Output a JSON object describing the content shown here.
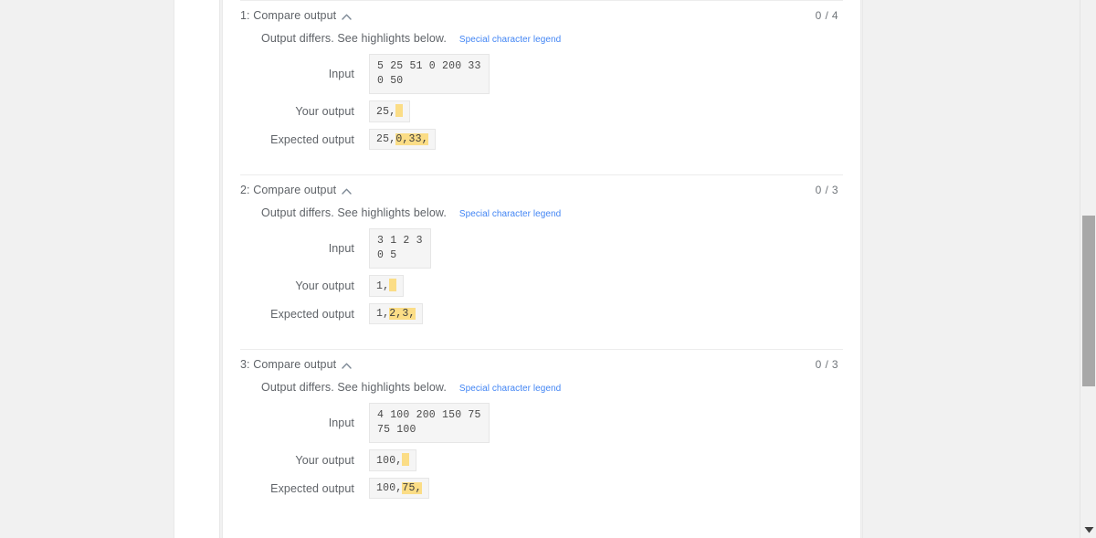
{
  "scrollbar": {
    "arrow_down_icon": "triangle-down-icon"
  },
  "results": {
    "sections": [
      {
        "title": "1: Compare output",
        "collapse_icon": "chevron-up-icon",
        "score": "0 / 4",
        "status_text": "Output differs. See highlights below.",
        "legend_link": "Special character legend",
        "input_label": "Input",
        "input_value": "5 25 51 0 200 33\n0 50",
        "your_output_label": "Your output",
        "your_output_prefix": "25,",
        "your_output_highlight": "",
        "expected_output_label": "Expected output",
        "expected_prefix": "25,",
        "expected_highlight": "0,33,"
      },
      {
        "title": "2: Compare output",
        "collapse_icon": "chevron-up-icon",
        "score": "0 / 3",
        "status_text": "Output differs. See highlights below.",
        "legend_link": "Special character legend",
        "input_label": "Input",
        "input_value": "3 1 2 3\n0 5",
        "your_output_label": "Your output",
        "your_output_prefix": "1,",
        "your_output_highlight": "",
        "expected_output_label": "Expected output",
        "expected_prefix": "1,",
        "expected_highlight": "2,3,"
      },
      {
        "title": "3: Compare output",
        "collapse_icon": "chevron-up-icon",
        "score": "0 / 3",
        "status_text": "Output differs. See highlights below.",
        "legend_link": "Special character legend",
        "input_label": "Input",
        "input_value": "4 100 200 150 75\n75 100",
        "your_output_label": "Your output",
        "your_output_prefix": "100,",
        "your_output_highlight": "",
        "expected_output_label": "Expected output",
        "expected_prefix": "100,",
        "expected_highlight": "75,"
      }
    ]
  },
  "colors": {
    "link": "#4285f4",
    "highlight": "#fbdd86",
    "code_bg": "#f5f5f5",
    "text": "#5f6368"
  }
}
